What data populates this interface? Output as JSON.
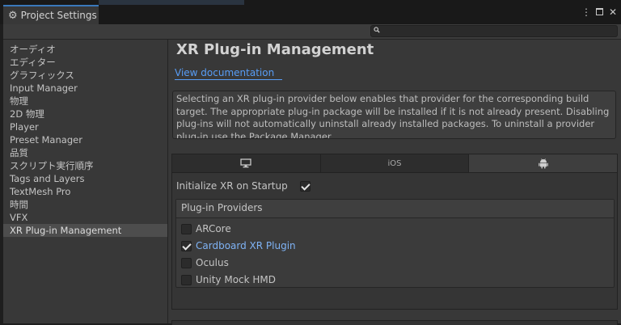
{
  "window": {
    "tab_title": "Project Settings",
    "icons": [
      "gear-icon",
      "more-vert-icon",
      "maximize-icon",
      "close-icon"
    ]
  },
  "search": {
    "value": "",
    "placeholder": ""
  },
  "sidebar": {
    "items": [
      {
        "label": "オーディオ",
        "selected": false
      },
      {
        "label": "エディター",
        "selected": false
      },
      {
        "label": "グラフィックス",
        "selected": false
      },
      {
        "label": "Input Manager",
        "selected": false
      },
      {
        "label": "物理",
        "selected": false
      },
      {
        "label": "2D 物理",
        "selected": false
      },
      {
        "label": "Player",
        "selected": false
      },
      {
        "label": "Preset Manager",
        "selected": false
      },
      {
        "label": "品質",
        "selected": false
      },
      {
        "label": "スクリプト実行順序",
        "selected": false
      },
      {
        "label": "Tags and Layers",
        "selected": false
      },
      {
        "label": "TextMesh Pro",
        "selected": false
      },
      {
        "label": "時間",
        "selected": false
      },
      {
        "label": "VFX",
        "selected": false
      },
      {
        "label": "XR Plug-in Management",
        "selected": true
      }
    ]
  },
  "main": {
    "title": "XR Plug-in Management",
    "doc_link": "View documentation",
    "help_text": "Selecting an XR plug-in provider below enables that provider for the corresponding build target. The appropriate plug-in package will be installed if it is not already present. Disabling plug-ins will not automatically uninstall already installed packages. To uninstall a provider plug-in use the Package Manager.",
    "platform_tabs": [
      {
        "icon": "monitor-icon",
        "label": "",
        "active": false
      },
      {
        "icon": "",
        "label": "iOS",
        "active": false
      },
      {
        "icon": "android-icon",
        "label": "",
        "active": true
      }
    ],
    "init_on_startup": {
      "label": "Initialize XR on Startup",
      "checked": true
    },
    "providers": {
      "header": "Plug-in Providers",
      "items": [
        {
          "label": "ARCore",
          "checked": false
        },
        {
          "label": "Cardboard XR Plugin",
          "checked": true
        },
        {
          "label": "Oculus",
          "checked": false
        },
        {
          "label": "Unity Mock HMD",
          "checked": false
        }
      ]
    }
  },
  "colors": {
    "accent": "#3a79bb",
    "link": "#589df6",
    "panel_bg": "#383838",
    "selected_bg": "#4d4d4d"
  }
}
